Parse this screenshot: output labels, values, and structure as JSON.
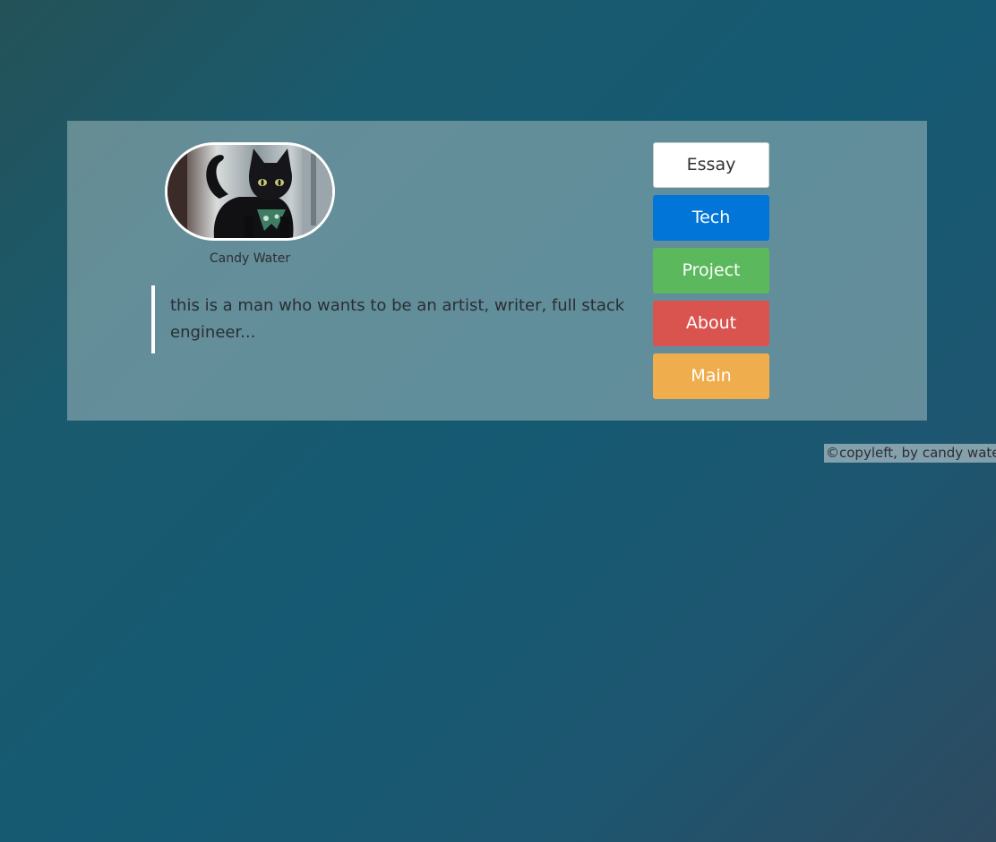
{
  "profile": {
    "avatar_icon": "black-cat-photo",
    "name": "Candy Water"
  },
  "quote": {
    "text": "this is a man who wants to be an artist, writer, full stack engineer..."
  },
  "nav": {
    "buttons": [
      {
        "label": "Essay",
        "color": "#ffffff"
      },
      {
        "label": "Tech",
        "color": "#0275d8"
      },
      {
        "label": "Project",
        "color": "#5cb85c"
      },
      {
        "label": "About",
        "color": "#d9534f"
      },
      {
        "label": "Main",
        "color": "#f0ad4e"
      }
    ]
  },
  "footer": {
    "text": "©copyleft, by candy water"
  }
}
